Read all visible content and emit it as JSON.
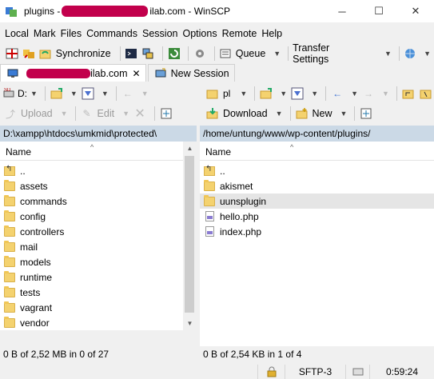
{
  "window": {
    "title_prefix": "plugins - ",
    "title_suffix": "ilab.com - WinSCP",
    "minimize": "─",
    "maximize": "☐",
    "close": "✕"
  },
  "menu": [
    "Local",
    "Mark",
    "Files",
    "Commands",
    "Session",
    "Options",
    "Remote",
    "Help"
  ],
  "toolbar": {
    "synchronize": "Synchronize",
    "queue": "Queue",
    "transfer_settings": "Transfer Settings"
  },
  "tabs": {
    "session_suffix": "ilab.com",
    "new_session": "New Session"
  },
  "left": {
    "drive": "D:",
    "upload": "Upload",
    "edit": "Edit",
    "path": "D:\\xampp\\htdocs\\umkmid\\protected\\",
    "column_name": "Name",
    "items": [
      {
        "name": "..",
        "type": "up"
      },
      {
        "name": "assets",
        "type": "folder"
      },
      {
        "name": "commands",
        "type": "folder"
      },
      {
        "name": "config",
        "type": "folder"
      },
      {
        "name": "controllers",
        "type": "folder"
      },
      {
        "name": "mail",
        "type": "folder"
      },
      {
        "name": "models",
        "type": "folder"
      },
      {
        "name": "runtime",
        "type": "folder"
      },
      {
        "name": "tests",
        "type": "folder"
      },
      {
        "name": "vagrant",
        "type": "folder"
      },
      {
        "name": "vendor",
        "type": "folder"
      }
    ],
    "status": "0 B of 2,52 MB in 0 of 27"
  },
  "right": {
    "dir": "pl",
    "download": "Download",
    "new": "New",
    "path": "/home/untung/www/wp-content/plugins/",
    "column_name": "Name",
    "items": [
      {
        "name": "..",
        "type": "up"
      },
      {
        "name": "akismet",
        "type": "folder"
      },
      {
        "name": "uunsplugin",
        "type": "folder",
        "selected": true
      },
      {
        "name": "hello.php",
        "type": "php"
      },
      {
        "name": "index.php",
        "type": "php"
      }
    ],
    "status": "0 B of 2,54 KB in 1 of 4"
  },
  "statusbar": {
    "protocol": "SFTP-3",
    "time": "0:59:24"
  },
  "colors": {
    "redaction": "#c2004c",
    "path_bar": "#cbd9e6",
    "folder": "#f4d26f"
  }
}
